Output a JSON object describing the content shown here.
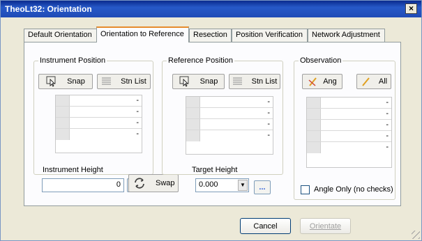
{
  "window": {
    "title": "TheoLt32: Orientation",
    "close_label": "×"
  },
  "tabs": [
    {
      "label": "Default Orientation"
    },
    {
      "label": "Orientation to Reference"
    },
    {
      "label": "Resection"
    },
    {
      "label": "Position Verification"
    },
    {
      "label": "Network Adjustment"
    }
  ],
  "instrument": {
    "group_label": "Instrument Position",
    "snap_label": "Snap",
    "stn_list_label": "Stn List",
    "grid_values": [
      "-",
      "-",
      "-",
      "-"
    ],
    "height_label": "Instrument Height",
    "height_value": "0",
    "dots_label": "..."
  },
  "swap": {
    "label": "Swap"
  },
  "reference": {
    "group_label": "Reference Position",
    "snap_label": "Snap",
    "stn_list_label": "Stn List",
    "grid_values": [
      "-",
      "-",
      "-",
      "-"
    ],
    "target_height_label": "Target Height",
    "target_height_value": "0.000",
    "dots_label": "..."
  },
  "observation": {
    "group_label": "Observation",
    "ang_label": "Ang",
    "all_label": "All",
    "grid_values": [
      "-",
      "-",
      "-",
      "-",
      "-"
    ],
    "angle_only_label": "Angle Only (no checks)"
  },
  "footer": {
    "cancel_label": "Cancel",
    "orientate_label": "Orientate"
  },
  "colors": {
    "titlebar": "#0a2a8e",
    "dialog_bg": "#ece9d8",
    "panel_bg": "#fcfcfe",
    "accent": "#e68b2c"
  }
}
